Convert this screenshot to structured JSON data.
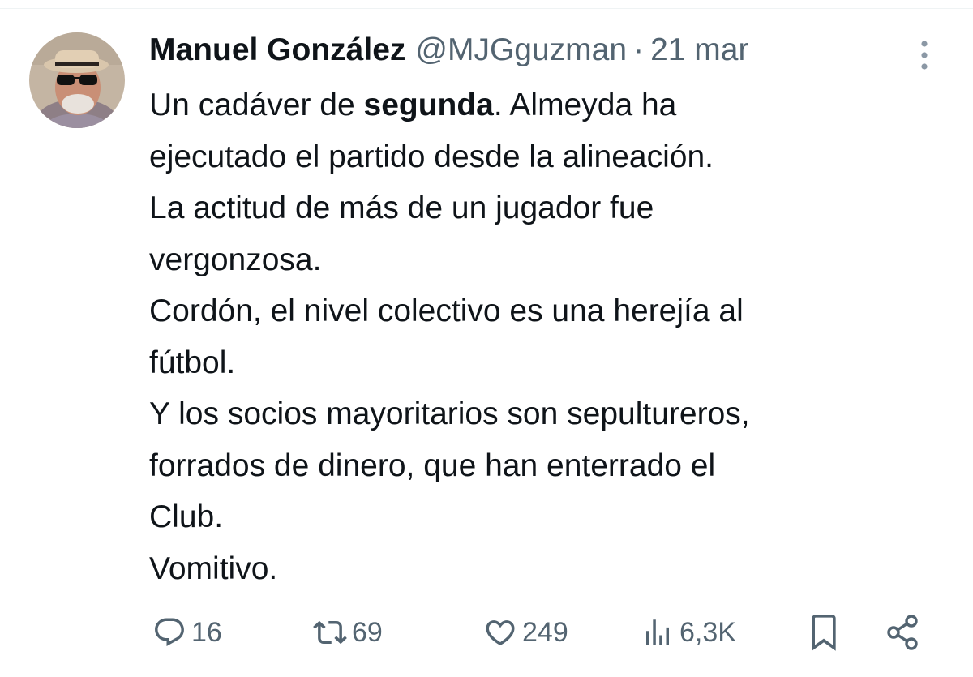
{
  "tweet": {
    "author_name": "Manuel González",
    "handle": "@MJGguzman",
    "separator": "·",
    "date": "21 mar",
    "text": {
      "line1_pre": "Un cadáver de ",
      "line1_bold": "segunda",
      "line1_post": ". Almeyda ha",
      "line2": "ejecutado el partido desde la alineación.",
      "line3": "La actitud de más de un jugador fue",
      "line4": "vergonzosa.",
      "line5": "Cordón, el nivel colectivo es una herejía al",
      "line6": "fútbol.",
      "line7": "Y los socios mayoritarios son sepultureros,",
      "line8": "forrados de dinero, que han enterrado el",
      "line9": "Club.",
      "line10": "Vomitivo."
    }
  },
  "actions": {
    "replies": "16",
    "retweets": "69",
    "likes": "249",
    "views": "6,3K"
  },
  "icons": {
    "avatar": "avatar",
    "more": "more-vertical-icon",
    "reply": "reply-icon",
    "retweet": "retweet-icon",
    "like": "heart-icon",
    "views": "views-chart-icon",
    "bookmark": "bookmark-icon",
    "share": "share-icon"
  },
  "colors": {
    "text_primary": "#0f1419",
    "text_secondary": "#536471"
  }
}
